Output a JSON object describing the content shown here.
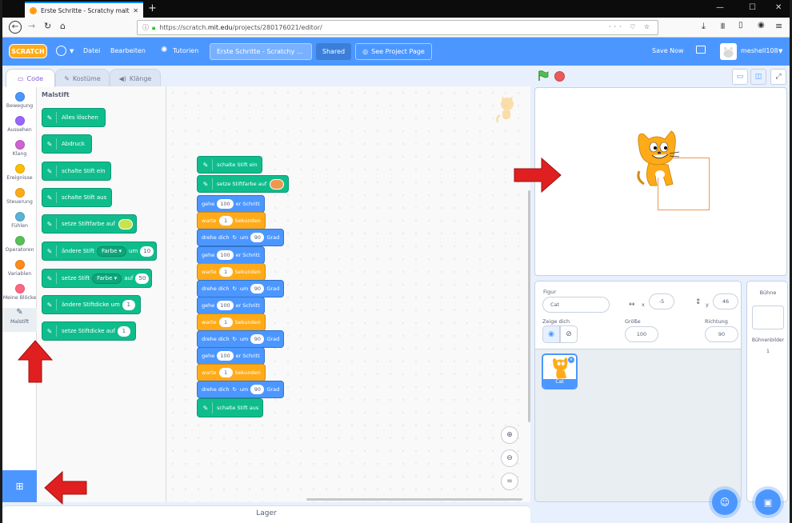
{
  "browser": {
    "tab_title": "Erste Schritte - Scratchy malt o",
    "url_prefix": "https://scratch.",
    "url_domain": "mit.edu",
    "url_path": "/projects/280176021/editor/",
    "url_right_icons": "··· ♡ ☆"
  },
  "menubar": {
    "logo": "SCRATCH",
    "file": "Datei",
    "edit": "Bearbeiten",
    "tutorials": "Tutorien",
    "project_title": "Erste Schritte - Scratchy ...",
    "shared": "Shared",
    "see_project_page": "See Project Page",
    "save_now": "Save Now",
    "username": "meshell108"
  },
  "editor_tabs": {
    "code": "Code",
    "costumes": "Kostüme",
    "sounds": "Klänge"
  },
  "categories": [
    {
      "label": "Bewegung",
      "color": "#4c97ff"
    },
    {
      "label": "Aussehen",
      "color": "#9966ff"
    },
    {
      "label": "Klang",
      "color": "#cf63cf"
    },
    {
      "label": "Ereignisse",
      "color": "#ffbf00"
    },
    {
      "label": "Steuerung",
      "color": "#ffab19"
    },
    {
      "label": "Fühlen",
      "color": "#5cb1d6"
    },
    {
      "label": "Operatoren",
      "color": "#59c059"
    },
    {
      "label": "Variablen",
      "color": "#ff8c1a"
    },
    {
      "label": "Meine Blöcke",
      "color": "#ff6680"
    },
    {
      "label": "Malstift",
      "color": "#0fbd8c"
    }
  ],
  "palette": {
    "heading": "Malstift",
    "blocks": {
      "clear": "Alles löschen",
      "stamp": "Abdruck",
      "pen_down": "schalte Stift ein",
      "pen_up": "schalte Stift aus",
      "set_color": "setze Stiftfarbe auf",
      "change_param_pre": "ändere Stift",
      "change_param_drop": "Farbe",
      "change_param_mid": "um",
      "change_param_val": "10",
      "set_param_pre": "setze Stift",
      "set_param_drop": "Farbe",
      "set_param_mid": "auf",
      "set_param_val": "50",
      "change_size": "ändere Stiftdicke um",
      "change_size_val": "1",
      "set_size": "setze Stiftdicke auf",
      "set_size_val": "1"
    }
  },
  "script": {
    "pen_down": "schalte Stift ein",
    "set_color": "setze Stiftfarbe auf",
    "move_pre": "gehe",
    "move_val": "100",
    "move_post": "er Schritt",
    "wait_pre": "warte",
    "wait_val": "1",
    "wait_post": "Sekunden",
    "turn_pre": "drehe dich",
    "turn_mid": "um",
    "turn_val": "90",
    "turn_post": "Grad",
    "pen_up": "schalte Stift aus"
  },
  "stage_colors": {
    "pen_rect": "#f0974f",
    "set_color_swatch": "#f0974f",
    "palette_swatch": "#c7e44b"
  },
  "lager": "Lager",
  "sprite_info": {
    "sprite_label": "Figur",
    "sprite_name": "Cat",
    "x_label": "x",
    "x_value": "-5",
    "y_label": "y",
    "y_value": "46",
    "show_label": "Zeige dich",
    "size_label": "Größe",
    "size_value": "100",
    "direction_label": "Richtung",
    "direction_value": "90"
  },
  "sprite_thumb": {
    "name": "Cat"
  },
  "backdrop": {
    "title": "Bühne",
    "label": "Bühnenbilder",
    "count": "1"
  }
}
